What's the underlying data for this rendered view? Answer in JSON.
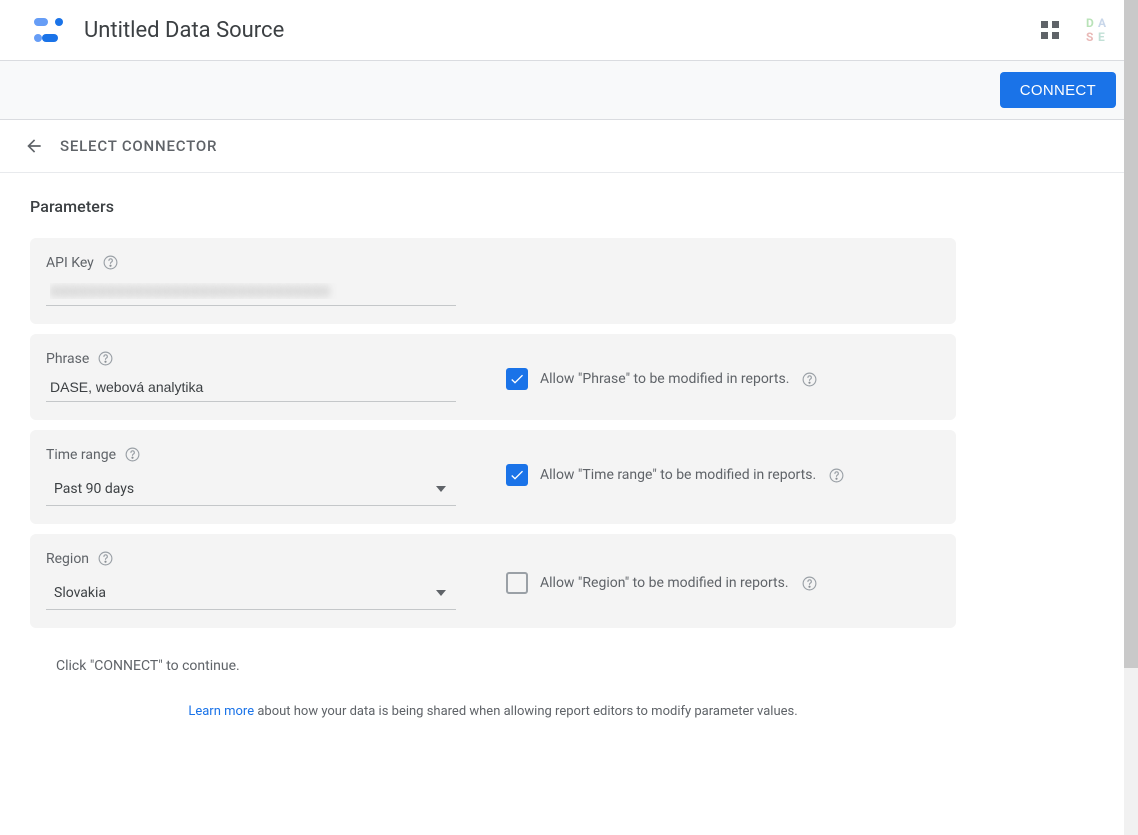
{
  "header": {
    "title": "Untitled Data Source"
  },
  "actionbar": {
    "connect_label": "CONNECT"
  },
  "breadcrumb": {
    "label": "SELECT CONNECTOR"
  },
  "section": {
    "title": "Parameters"
  },
  "params": {
    "api_key": {
      "label": "API Key",
      "value": "XXXXXXXXXXXXXXXXXXXXXXXXXXXXXX"
    },
    "phrase": {
      "label": "Phrase",
      "value": "DASE, webová analytika",
      "allow_label": "Allow \"Phrase\" to be modified in reports.",
      "allow_checked": true
    },
    "time_range": {
      "label": "Time range",
      "value": "Past 90 days",
      "allow_label": "Allow \"Time range\" to be modified in reports.",
      "allow_checked": true
    },
    "region": {
      "label": "Region",
      "value": "Slovakia",
      "allow_label": "Allow \"Region\" to be modified in reports.",
      "allow_checked": false
    }
  },
  "footer": {
    "hint": "Click \"CONNECT\" to continue.",
    "learn_more": "Learn more",
    "learn_more_rest": " about how your data is being shared when allowing report editors to modify parameter values."
  }
}
